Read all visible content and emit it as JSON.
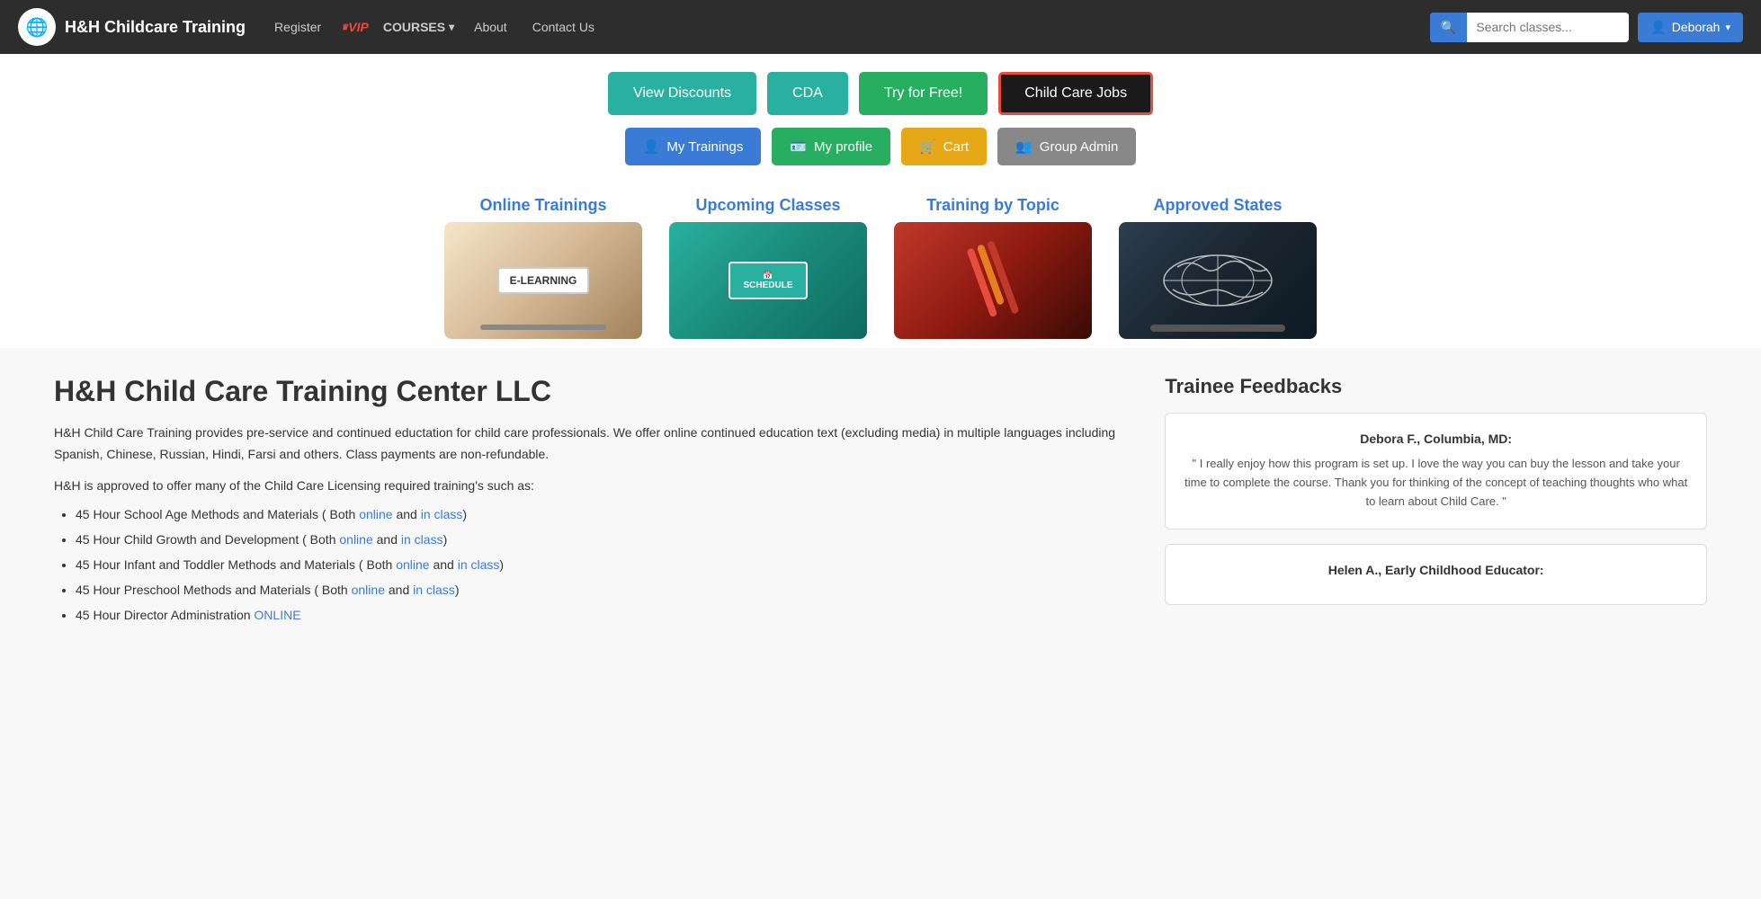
{
  "navbar": {
    "brand": "H&H Childcare Training",
    "logo_icon": "🌐",
    "register_label": "Register",
    "vip_label": "VIP",
    "courses_label": "COURSES",
    "about_label": "About",
    "contact_label": "Contact Us",
    "search_placeholder": "Search classes...",
    "user_label": "Deborah"
  },
  "hero": {
    "btn1_label": "View Discounts",
    "btn2_label": "CDA",
    "btn3_label": "Try for Free!",
    "btn4_label": "Child Care Jobs",
    "btn5_label": "My Trainings",
    "btn5_icon": "👤",
    "btn6_label": "My profile",
    "btn6_icon": "🪪",
    "btn7_label": "Cart",
    "btn7_icon": "🛒",
    "btn8_label": "Group Admin",
    "btn8_icon": "👥"
  },
  "categories": [
    {
      "title": "Online Trainings",
      "img_type": "online",
      "img_label": "E-LEARNING"
    },
    {
      "title": "Upcoming Classes",
      "img_type": "upcoming",
      "img_label": "SCHEDULE"
    },
    {
      "title": "Training by Topic",
      "img_type": "topic",
      "img_label": ""
    },
    {
      "title": "Approved States",
      "img_type": "states",
      "img_label": ""
    }
  ],
  "main": {
    "title": "H&H Child Care Training Center LLC",
    "desc1": "H&H Child Care Training provides pre-service and continued eductation for child care professionals. We offer online continued education text (excluding media) in multiple languages including Spanish, Chinese, Russian, Hindi, Farsi and others. Class payments are non-refundable.",
    "desc2": "H&H is approved to offer many of the Child Care Licensing required training's such as:",
    "list_items": [
      {
        "text": "45 Hour School Age Methods and Materials ( Both ",
        "link1": "online",
        "mid": " and ",
        "link2": "in class",
        "end": ")"
      },
      {
        "text": "45 Hour Child Growth and Development ( Both ",
        "link1": "online",
        "mid": " and ",
        "link2": "in class",
        "end": ")"
      },
      {
        "text": "45 Hour Infant and Toddler Methods and Materials ( Both ",
        "link1": "online",
        "mid": " and ",
        "link2": "in class",
        "end": ")"
      },
      {
        "text": "45 Hour Preschool Methods and Materials ( Both ",
        "link1": "online",
        "mid": " and ",
        "link2": "in class",
        "end": ")"
      },
      {
        "text": "45 Hour Director Administration ONLINE",
        "link1": "",
        "mid": "",
        "link2": "",
        "end": ""
      }
    ]
  },
  "feedback": {
    "title": "Trainee Feedbacks",
    "cards": [
      {
        "author": "Debora F., Columbia, MD:",
        "text": "\" I really enjoy how this program is set up. I love the way you can buy the lesson and take your time to complete the course. Thank you for thinking of the concept of teaching thoughts who what to learn about Child Care. \""
      },
      {
        "author": "Helen A., Early Childhood Educator:",
        "text": ""
      }
    ]
  }
}
